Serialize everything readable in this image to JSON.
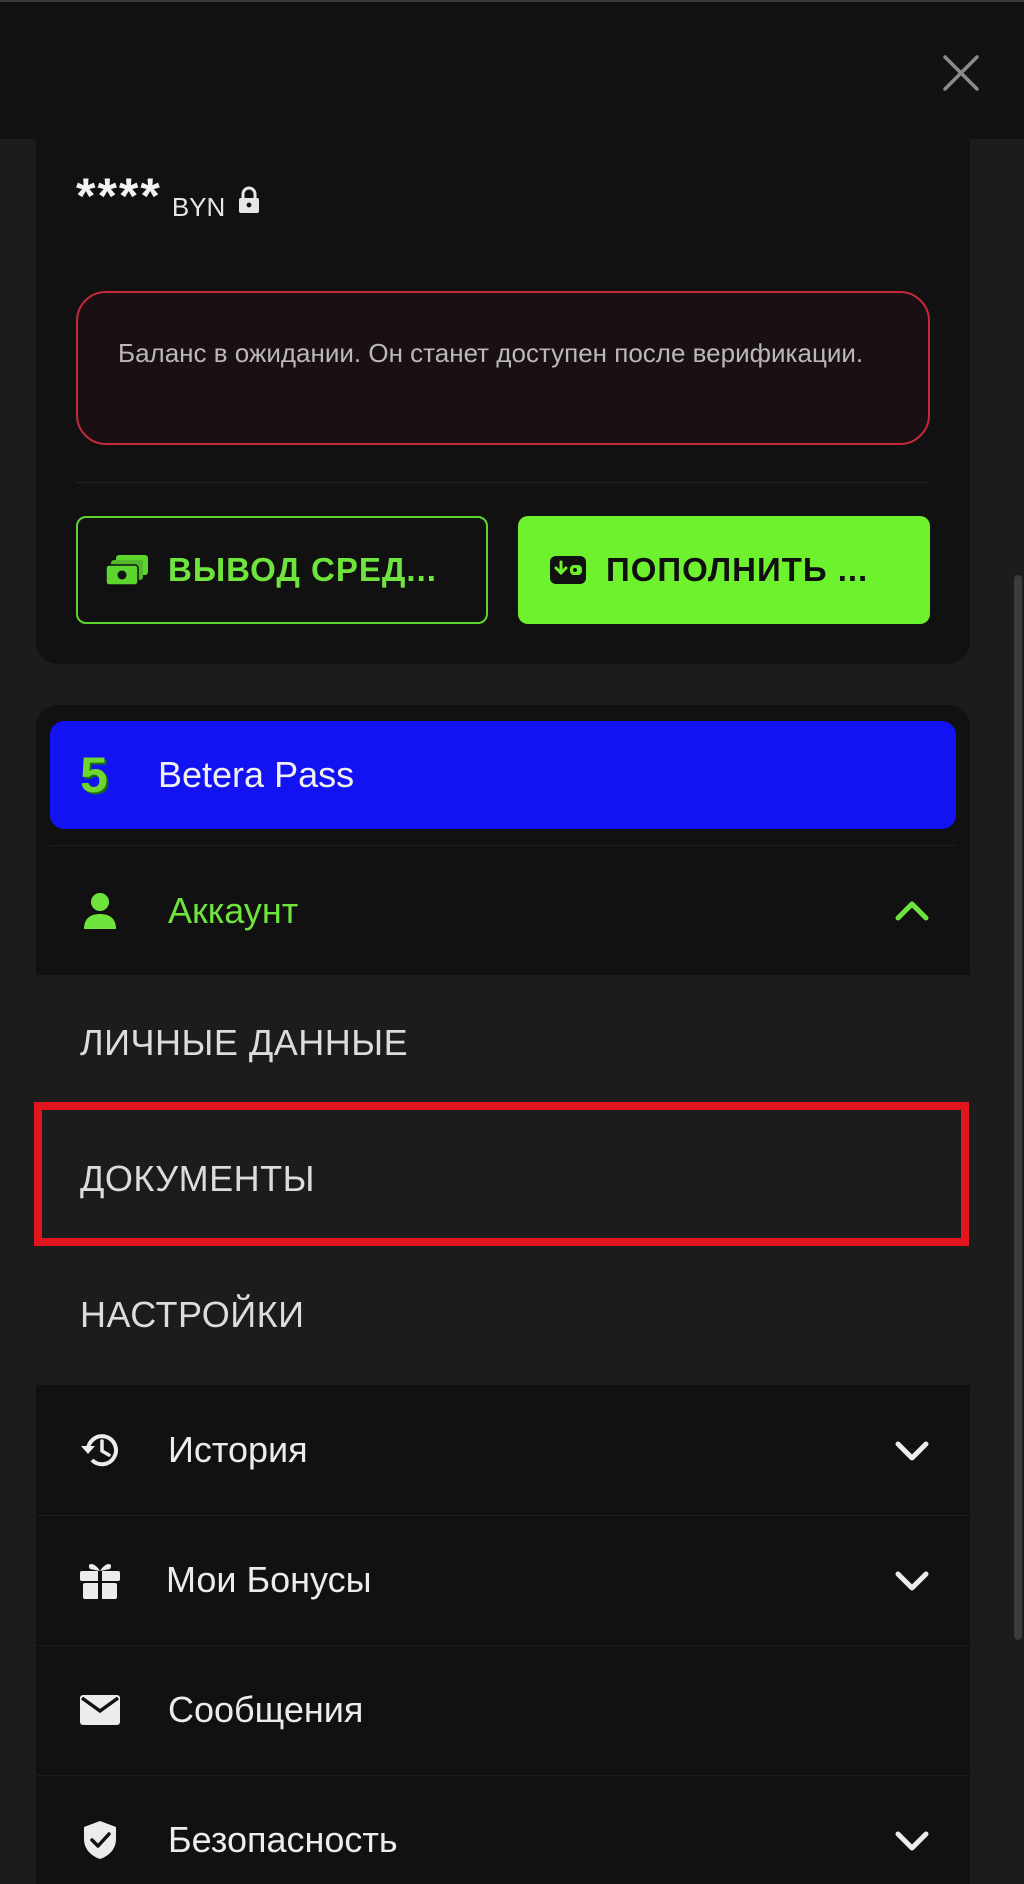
{
  "balance": {
    "value": "****",
    "currency": "BYN"
  },
  "notice": {
    "text": "Баланс в ожидании. Он станет доступен после верификации."
  },
  "actions": {
    "withdraw_label": "ВЫВОД СРЕД...",
    "deposit_label": "ПОПОЛНИТЬ ..."
  },
  "menu": {
    "pass": {
      "badge": "5",
      "label": "Betera Pass"
    },
    "account": {
      "label": "Аккаунт",
      "subitems": [
        {
          "label": "ЛИЧНЫЕ ДАННЫЕ"
        },
        {
          "label": "ДОКУМЕНТЫ"
        },
        {
          "label": "НАСТРОЙКИ"
        }
      ]
    },
    "items": [
      {
        "label": "История"
      },
      {
        "label": "Мои Бонусы"
      },
      {
        "label": "Сообщения"
      },
      {
        "label": "Безопасность"
      }
    ]
  },
  "colors": {
    "accent": "#6ef22e",
    "pass_bg": "#1212f2",
    "alert_border": "#c4283a",
    "highlight": "#e0151e"
  }
}
